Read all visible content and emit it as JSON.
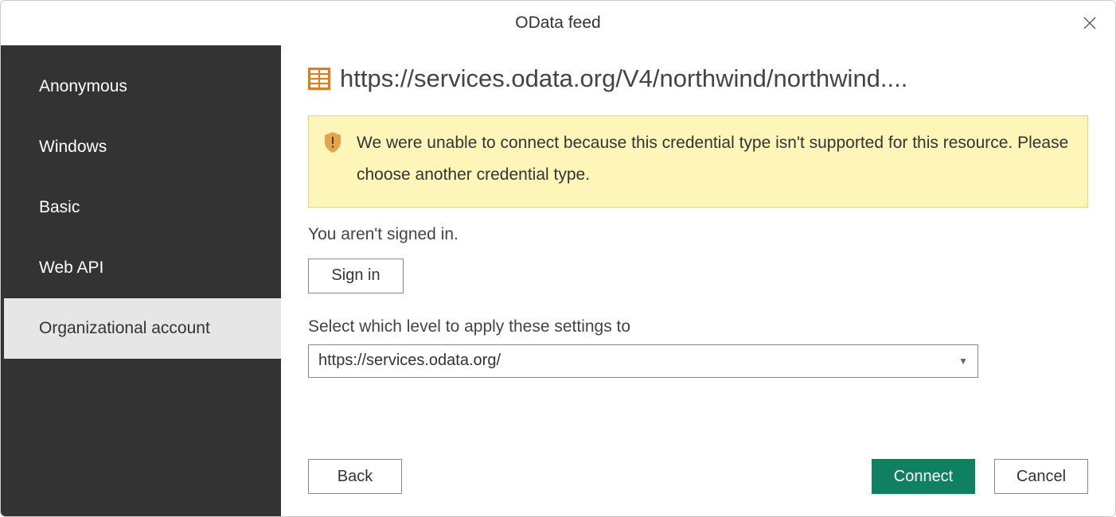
{
  "header": {
    "title": "OData feed"
  },
  "sidebar": {
    "items": [
      {
        "label": "Anonymous",
        "selected": false
      },
      {
        "label": "Windows",
        "selected": false
      },
      {
        "label": "Basic",
        "selected": false
      },
      {
        "label": "Web API",
        "selected": false
      },
      {
        "label": "Organizational account",
        "selected": true
      }
    ]
  },
  "main": {
    "url": "https://services.odata.org/V4/northwind/northwind....",
    "warning": "We were unable to connect because this credential type isn't supported for this resource. Please choose another credential type.",
    "signin_status": "You aren't signed in.",
    "signin_button": "Sign in",
    "level_label": "Select which level to apply these settings to",
    "level_value": "https://services.odata.org/"
  },
  "footer": {
    "back": "Back",
    "connect": "Connect",
    "cancel": "Cancel"
  },
  "colors": {
    "sidebar_bg": "#333333",
    "warning_bg": "#fef6b8",
    "primary": "#0f8060"
  }
}
